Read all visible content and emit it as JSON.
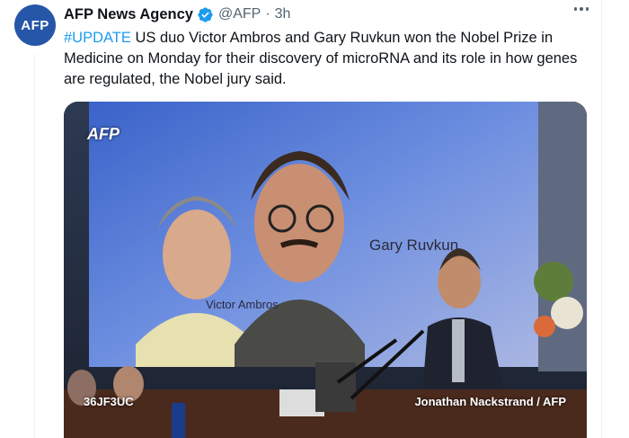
{
  "author": {
    "avatar_text": "AFP",
    "name": "AFP News Agency",
    "handle": "@AFP",
    "separator": "·",
    "time": "3h"
  },
  "tweet": {
    "hashtag": "#UPDATE",
    "text": " US duo Victor Ambros and Gary Ruvkun won the Nobel Prize in Medicine on Monday for their discovery of microRNA and its role in how genes are regulated, the Nobel jury said."
  },
  "media": {
    "logo": "AFP",
    "screen_label_left": "Victor Ambros",
    "screen_label_right": "Gary Ruvkun",
    "image_id": "36JF3UC",
    "credit": "Jonathan Nackstrand / AFP"
  },
  "icons": {
    "verified": "verified-badge-icon",
    "more": "more-options-icon"
  },
  "colors": {
    "link": "#1d9bf0",
    "verified": "#1d9bf0",
    "avatar_bg": "#2656a8",
    "secondary_text": "#536471"
  }
}
